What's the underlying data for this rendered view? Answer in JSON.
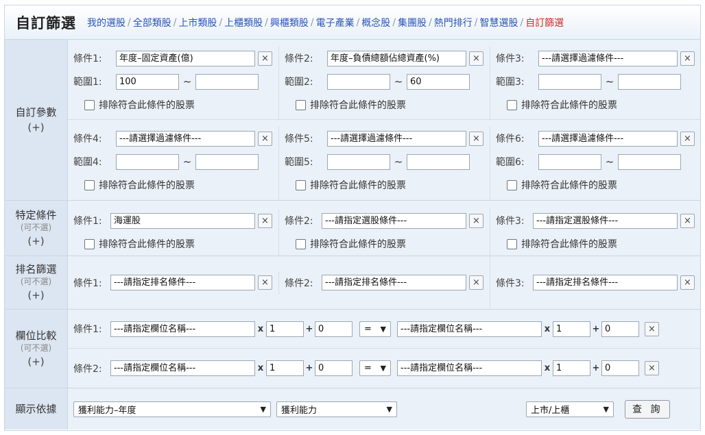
{
  "header": {
    "title": "自訂篩選",
    "nav": [
      "我的選股",
      "全部類股",
      "上市類股",
      "上櫃類股",
      "興櫃類股",
      "電子產業",
      "概念股",
      "集團股",
      "熱門排行",
      "智慧選股",
      "自訂篩選"
    ]
  },
  "custom": {
    "label": "自訂參數",
    "plus": "(+)",
    "range_sep": "~",
    "exclude": "排除符合此條件的股票",
    "clear": "×",
    "conds": [
      {
        "label": "條件1:",
        "range": "範圍1:",
        "value": "年度–固定資產(億)",
        "min": "100",
        "max": ""
      },
      {
        "label": "條件2:",
        "range": "範圍2:",
        "value": "年度–負債總額佔總資產(%)",
        "min": "",
        "max": "60"
      },
      {
        "label": "條件3:",
        "range": "範圍3:",
        "value": "---請選擇過濾條件---",
        "min": "",
        "max": ""
      },
      {
        "label": "條件4:",
        "range": "範圍4:",
        "value": "---請選擇過濾條件---",
        "min": "",
        "max": ""
      },
      {
        "label": "條件5:",
        "range": "範圍5:",
        "value": "---請選擇過濾條件---",
        "min": "",
        "max": ""
      },
      {
        "label": "條件6:",
        "range": "範圍6:",
        "value": "---請選擇過濾條件---",
        "min": "",
        "max": ""
      }
    ]
  },
  "specific": {
    "label": "特定條件",
    "sub": "(可不選)",
    "plus": "(+)",
    "conds": [
      {
        "label": "條件1:",
        "value": "海運股"
      },
      {
        "label": "條件2:",
        "value": "---請指定選股條件---"
      },
      {
        "label": "條件3:",
        "value": "---請指定選股條件---"
      }
    ]
  },
  "rank": {
    "label": "排名篩選",
    "sub": "(可不選)",
    "plus": "(+)",
    "conds": [
      {
        "label": "條件1:",
        "value": "---請指定排名條件---"
      },
      {
        "label": "條件2:",
        "value": "---請指定排名條件---"
      },
      {
        "label": "條件3:",
        "value": "---請指定排名條件---"
      }
    ]
  },
  "compare": {
    "label": "欄位比較",
    "sub": "(可不選)",
    "plus": "(+)",
    "mul": "x",
    "add": "+",
    "conds": [
      {
        "label": "條件1:",
        "left_field": "---請指定欄位名稱---",
        "left_mul": "1",
        "left_add": "0",
        "op": "=",
        "right_field": "---請指定欄位名稱---",
        "right_mul": "1",
        "right_add": "0"
      },
      {
        "label": "條件2:",
        "left_field": "---請指定欄位名稱---",
        "left_mul": "1",
        "left_add": "0",
        "op": "=",
        "right_field": "---請指定欄位名稱---",
        "right_mul": "1",
        "right_add": "0"
      }
    ]
  },
  "display": {
    "label": "顯示依據",
    "category": "獲利能力–年度",
    "subcategory": "獲利能力",
    "market": "上市/上櫃",
    "query": "查 詢"
  }
}
